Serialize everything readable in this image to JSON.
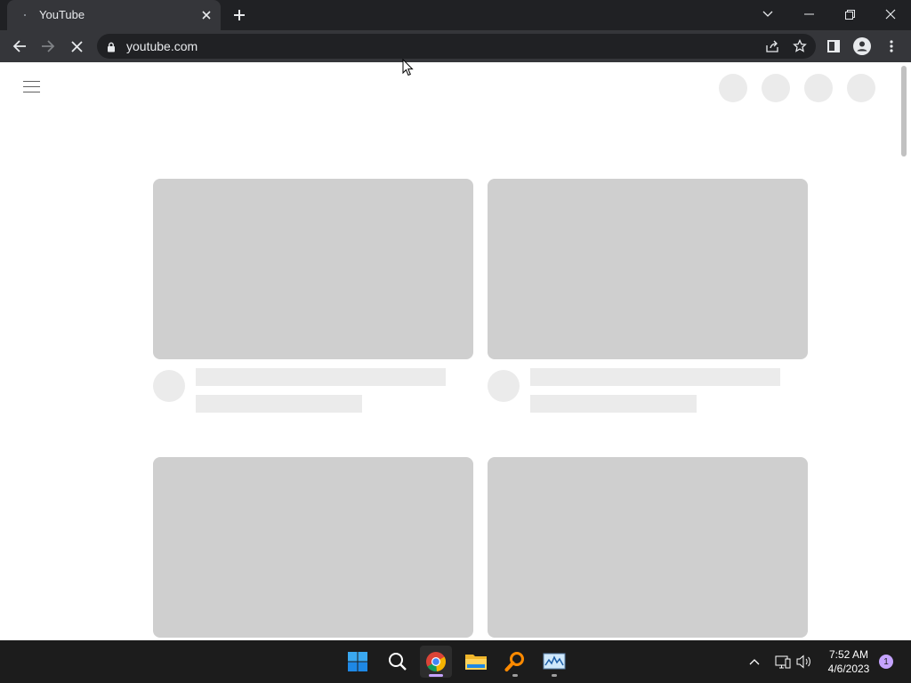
{
  "browser": {
    "tab": {
      "title": "YouTube"
    },
    "url": "youtube.com"
  },
  "taskbar": {
    "time": "7:52 AM",
    "date": "4/6/2023",
    "notification_count": "1",
    "apps": [
      "start-icon",
      "search-icon",
      "chrome-icon",
      "file-explorer-icon",
      "search-tool-icon",
      "resource-monitor-icon"
    ]
  },
  "colors": {
    "titlebar": "#202124",
    "toolbar": "#35363a",
    "skeleton_thumbnail": "#cfcfcf",
    "skeleton_text": "#ebebeb",
    "taskbar": "#1c1c1c"
  }
}
